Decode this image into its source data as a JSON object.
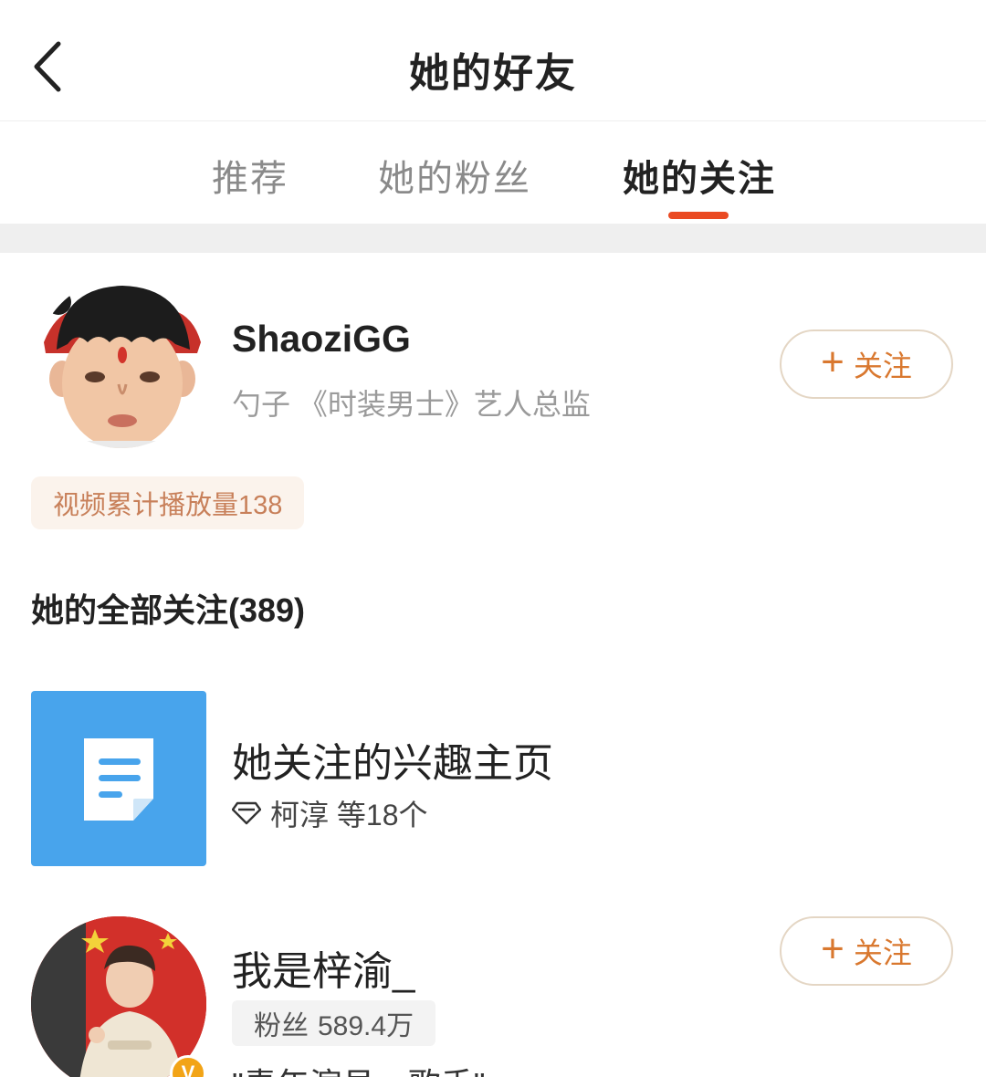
{
  "header": {
    "title": "她的好友"
  },
  "tabs": [
    {
      "label": "推荐"
    },
    {
      "label": "她的粉丝"
    },
    {
      "label": "她的关注"
    }
  ],
  "featured_user": {
    "name": "ShaoziGG",
    "description": "勺子 《时装男士》艺人总监",
    "follow_plus": "+",
    "follow_label": "关注",
    "play_count": "视频累计播放量138"
  },
  "following_section": {
    "title": "她的全部关注(389)"
  },
  "interest_page": {
    "title": "她关注的兴趣主页",
    "subtitle": "柯淳 等18个"
  },
  "user2": {
    "name": "我是梓渝_",
    "fans_label": "粉丝",
    "fans_count": "589.4万",
    "bio": "\"青年演员、歌手\"",
    "verified_mark": "V",
    "follow_plus": "+",
    "follow_label": "关注"
  },
  "colors": {
    "accent": "#ea4a22",
    "follow_text": "#d9782f",
    "interest_tile": "#48a4ec",
    "verified_badge": "#f2a417"
  }
}
